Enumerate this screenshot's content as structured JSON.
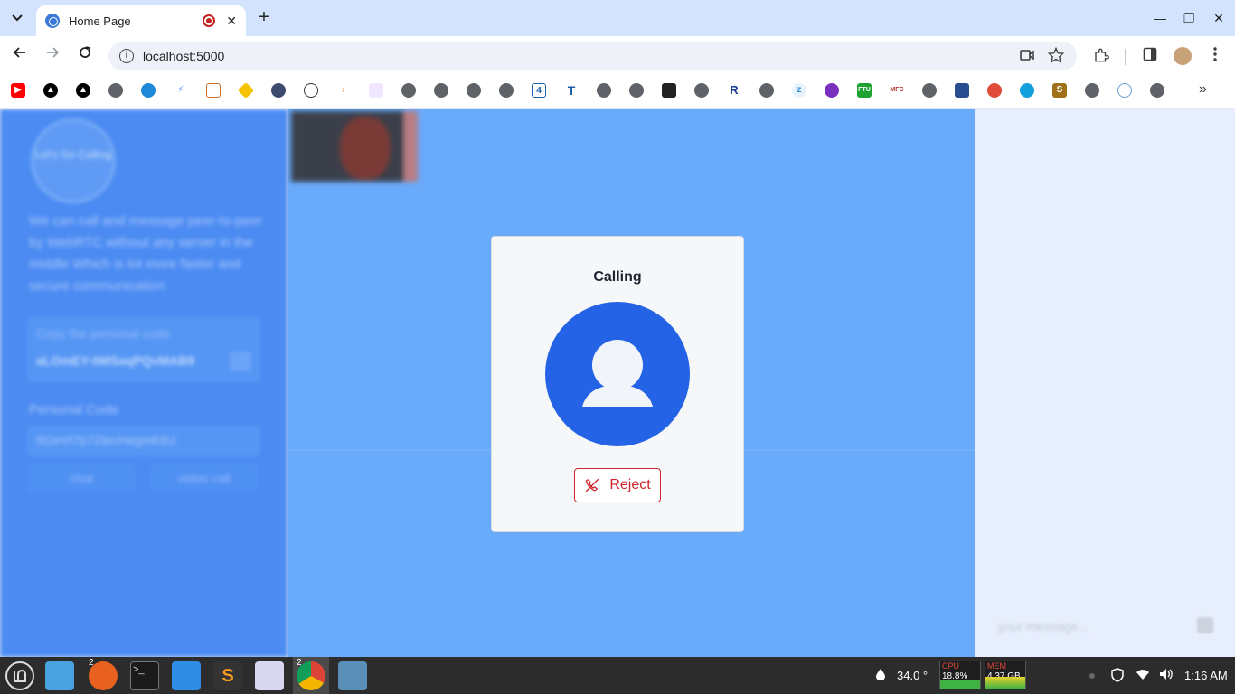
{
  "browser": {
    "tab_title": "Home Page",
    "url": "localhost:5000",
    "tab_close": "✕",
    "new_tab": "+",
    "window_controls": {
      "minimize": "—",
      "restore": "❐",
      "close": "✕"
    }
  },
  "app": {
    "logo_text": "Let's Go Calling",
    "description": "We can call and message peer-to-peer by WebRTC without any server in the middle Which is lot more faster and secure communication",
    "copy_hint": "Copy the personal code",
    "personal_code_value": "aLOmEY-0MSaqPQvMAB9",
    "personal_code_label": "Personal Code",
    "personal_code_input": "5t2eVt7p7ZtecHegmKBJ",
    "chat_button": "chat",
    "video_call_button": "video call",
    "chat_placeholder": "your message...",
    "dialog": {
      "title": "Calling",
      "reject_label": "Reject"
    },
    "colors": {
      "sidebar": "#4b8bf2",
      "main": "#6aaafa",
      "avatar": "#2563e6",
      "reject": "#d0262b"
    }
  },
  "taskbar": {
    "temperature": "34.0 °",
    "cpu_label": "CPU",
    "cpu_value": "18.8%",
    "mem_label": "MEM",
    "mem_value": "4.37 GB",
    "clock": "1:16 AM",
    "firefox_badge": "2",
    "chrome_badge": "2"
  }
}
